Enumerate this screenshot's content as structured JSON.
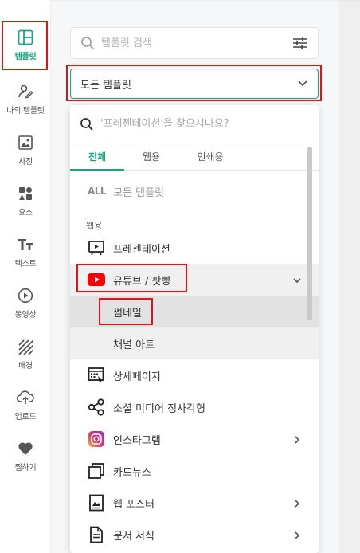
{
  "sidebar": {
    "items": [
      {
        "label": "템플릿",
        "icon": "template-icon",
        "active": true
      },
      {
        "label": "나의 템플릿",
        "icon": "my-template-icon"
      },
      {
        "label": "사진",
        "icon": "photo-icon"
      },
      {
        "label": "요소",
        "icon": "elements-icon"
      },
      {
        "label": "텍스트",
        "icon": "text-icon"
      },
      {
        "label": "동영상",
        "icon": "video-icon"
      },
      {
        "label": "배경",
        "icon": "background-icon"
      },
      {
        "label": "업로드",
        "icon": "upload-icon"
      },
      {
        "label": "찜하기",
        "icon": "heart-icon"
      }
    ]
  },
  "search": {
    "placeholder": "템플릿 검색"
  },
  "select": {
    "value": "모든 템플릿"
  },
  "dropdown": {
    "search_placeholder": "'프레젠테이션'을 찾으시나요?",
    "tabs": [
      "전체",
      "웹용",
      "인쇄용"
    ],
    "all_mark": "ALL",
    "all_label": "모든 템플릿",
    "section_web": "웹용",
    "items": [
      {
        "label": "프레젠테이션",
        "icon": "presentation-icon"
      },
      {
        "label": "유튜브 / 팟빵",
        "icon": "youtube-icon",
        "expanded": true
      },
      {
        "label": "썸네일",
        "sub": true
      },
      {
        "label": "채널 아트",
        "sub": true
      },
      {
        "label": "상세페이지",
        "icon": "detail-page-icon"
      },
      {
        "label": "소셜 미디어 정사각형",
        "icon": "share-icon"
      },
      {
        "label": "인스타그램",
        "icon": "instagram-icon",
        "has_children": true
      },
      {
        "label": "카드뉴스",
        "icon": "card-news-icon"
      },
      {
        "label": "웹 포스터",
        "icon": "web-poster-icon",
        "has_children": true
      },
      {
        "label": "문서 서식",
        "icon": "document-icon",
        "has_children": true
      }
    ]
  },
  "colors": {
    "accent": "#13a77e",
    "highlight": "#e0131a",
    "youtube": "#ff0000"
  }
}
